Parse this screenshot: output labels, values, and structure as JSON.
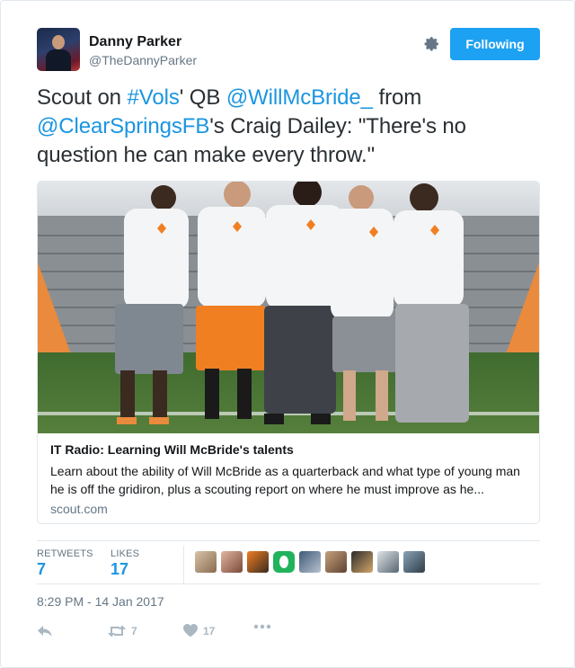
{
  "author": {
    "name": "Danny Parker",
    "handle": "@TheDannyParker"
  },
  "follow_button": {
    "label": "Following"
  },
  "tweet": {
    "segments": [
      {
        "text": "Scout on ",
        "link": false
      },
      {
        "text": "#Vols",
        "link": true
      },
      {
        "text": "' QB ",
        "link": false
      },
      {
        "text": "@WillMcBride_",
        "link": true
      },
      {
        "text": " from ",
        "link": false
      },
      {
        "text": "@ClearSpringsFB",
        "link": true
      },
      {
        "text": "'s Craig Dailey: \"There's no question he can make every throw.\"",
        "link": false
      }
    ]
  },
  "link_card": {
    "title": "IT Radio: Learning Will McBride's talents",
    "description": "Learn about the ability of Will McBride as a quarterback and what type of young man he is off the gridiron, plus a scouting report on where he must improve as he...",
    "domain": "scout.com"
  },
  "stats": {
    "retweets_label": "RETWEETS",
    "retweets_value": "7",
    "likes_label": "LIKES",
    "likes_value": "17"
  },
  "timestamp": "8:29 PM - 14 Jan 2017",
  "actions": {
    "reply_icon": "reply-icon",
    "retweet_icon": "retweet-icon",
    "retweet_count": "7",
    "like_icon": "heart-icon",
    "like_count": "17",
    "more_icon": "more-icon"
  },
  "colors": {
    "accent": "#1da1f2",
    "link": "#1b95e0",
    "muted": "#657786",
    "action_gray": "#aab8c2"
  }
}
